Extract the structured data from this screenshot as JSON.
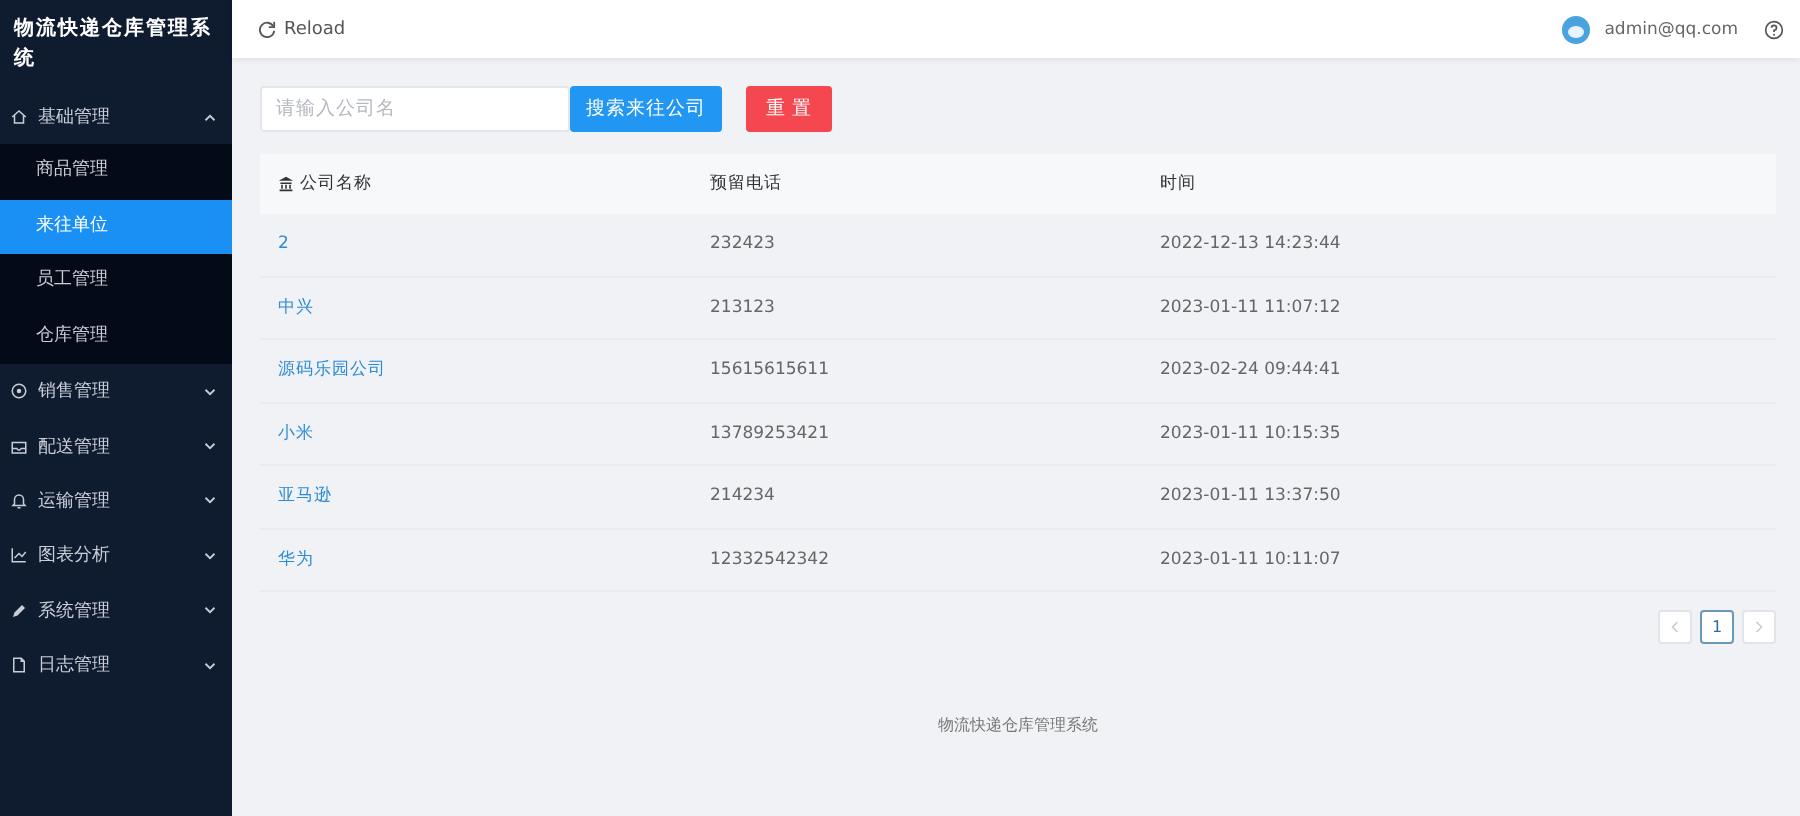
{
  "app_title": "物流快递仓库管理系统",
  "sidebar": {
    "groups": [
      {
        "label": "基础管理",
        "expanded": true,
        "children": [
          {
            "label": "商品管理",
            "selected": false
          },
          {
            "label": "来往单位",
            "selected": true
          },
          {
            "label": "员工管理",
            "selected": false
          },
          {
            "label": "仓库管理",
            "selected": false
          }
        ]
      },
      {
        "label": "销售管理",
        "expanded": false
      },
      {
        "label": "配送管理",
        "expanded": false
      },
      {
        "label": "运输管理",
        "expanded": false
      },
      {
        "label": "图表分析",
        "expanded": false
      },
      {
        "label": "系统管理",
        "expanded": false
      },
      {
        "label": "日志管理",
        "expanded": false
      }
    ]
  },
  "header": {
    "reload": "Reload",
    "user": "admin@qq.com"
  },
  "search": {
    "placeholder": "请输入公司名",
    "search_button": "搜索来往公司",
    "reset_button": "重 置"
  },
  "table": {
    "columns": [
      "公司名称",
      "预留电话",
      "时间"
    ],
    "rows": [
      [
        "2",
        "232423",
        "2022-12-13 14:23:44"
      ],
      [
        "中兴",
        "213123",
        "2023-01-11 11:07:12"
      ],
      [
        "源码乐园公司",
        "15615615611",
        "2023-02-24 09:44:41"
      ],
      [
        "小米",
        "13789253421",
        "2023-01-11 10:15:35"
      ],
      [
        "亚马逊",
        "214234",
        "2023-01-11 13:37:50"
      ],
      [
        "华为",
        "12332542342",
        "2023-01-11 10:11:07"
      ]
    ]
  },
  "pagination": {
    "prev_disabled": true,
    "next_disabled": true,
    "pages": [
      {
        "label": "1",
        "selected": true
      }
    ]
  },
  "footer": "物流快递仓库管理系统"
}
